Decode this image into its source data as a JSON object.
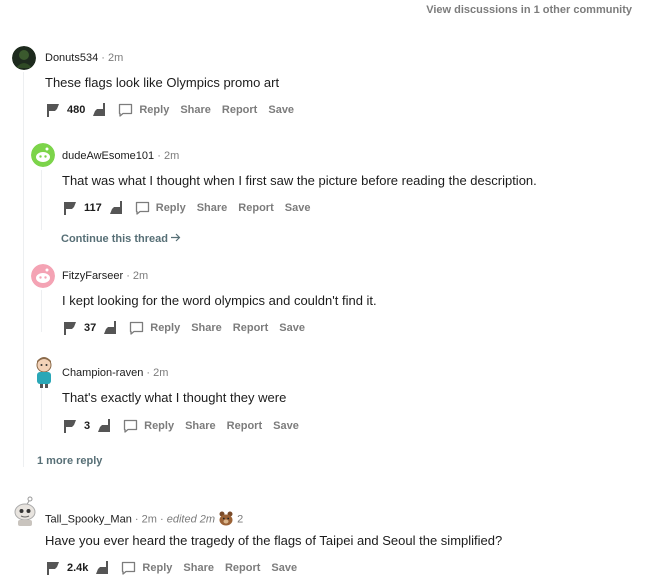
{
  "header": {
    "discussions_link": "View discussions in 1 other community"
  },
  "actions": {
    "reply": "Reply",
    "share": "Share",
    "report": "Report",
    "save": "Save"
  },
  "comments": [
    {
      "username": "Donuts534",
      "sep": "·",
      "time": "2m",
      "text": "These flags look like Olympics promo art",
      "votes": "480"
    },
    {
      "username": "dudeAwEsome101",
      "sep": "·",
      "time": "2m",
      "text": "That was what I thought when I first saw the picture before reading the description.",
      "votes": "117"
    },
    {
      "username": "FitzyFarseer",
      "sep": "·",
      "time": "2m",
      "text": "I kept looking for the word olympics and couldn't find it.",
      "votes": "37"
    },
    {
      "username": "Champion-raven",
      "sep": "·",
      "time": "2m",
      "text": "That's exactly what I thought they were",
      "votes": "3"
    },
    {
      "username": "Tall_Spooky_Man",
      "sep": "·",
      "time": "2m",
      "edited": "edited 2m",
      "award_count": "2",
      "text": "Have you ever heard the tragedy of the flags of Taipei and Seoul the simplified?",
      "votes": "2.4k"
    }
  ],
  "continue_thread": "Continue this thread",
  "more_replies": "1 more reply",
  "colors": {
    "text": "#1c1c1c",
    "muted": "#7c7c7c",
    "threadline": "#edeff1",
    "link": "#576f76"
  }
}
